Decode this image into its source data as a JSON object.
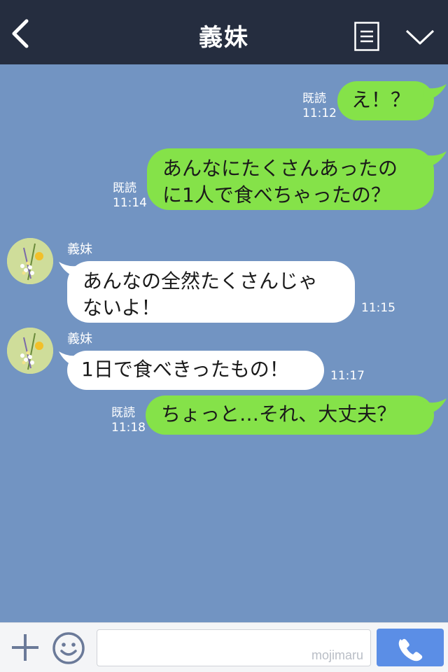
{
  "header": {
    "title": "義妹"
  },
  "messages": [
    {
      "text_lines": [
        "え！？"
      ],
      "read_label": "既読",
      "time": "11:12"
    },
    {
      "text_lines": [
        "あんなにたくさんあったの",
        "に1人で食べちゃったの？"
      ],
      "read_label": "既読",
      "time": "11:14"
    },
    {
      "sender": "義妹",
      "text_lines": [
        "あんなの全然たくさんじゃ",
        "ないよ！"
      ],
      "time": "11:15"
    },
    {
      "sender": "義妹",
      "text_lines": [
        "1日で食べきったもの！"
      ],
      "time": "11:17"
    },
    {
      "text_lines": [
        "ちょっと…それ、大丈夫？"
      ],
      "read_label": "既読",
      "time": "11:18"
    }
  ],
  "input": {
    "placeholder": "",
    "watermark": "mojimaru"
  },
  "colors": {
    "header_bg": "#252d3f",
    "chat_bg": "#7294c2",
    "outgoing_bubble": "#85e249",
    "incoming_bubble": "#ffffff",
    "call_button": "#5b8ee6"
  },
  "icons": [
    "back-chevron-icon",
    "menu-list-icon",
    "chevron-down-icon",
    "plus-icon",
    "emoji-icon",
    "phone-icon"
  ]
}
